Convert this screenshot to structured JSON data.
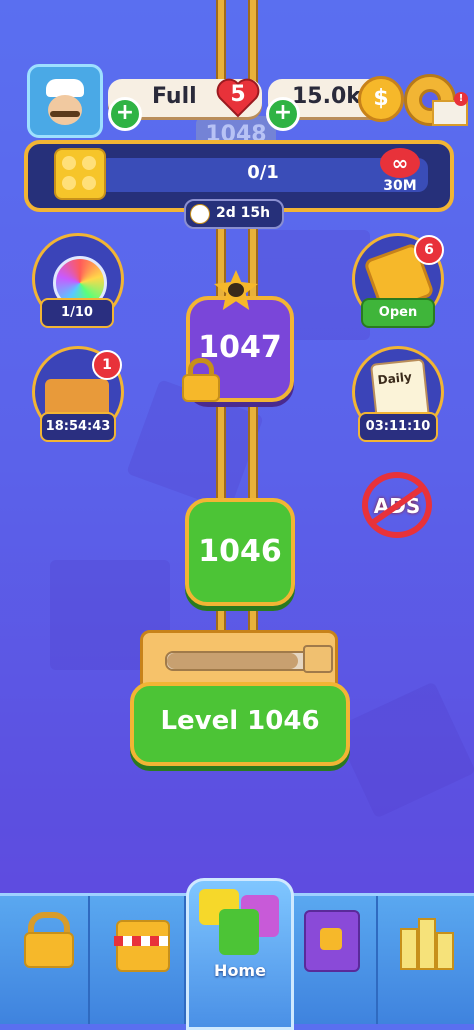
{
  "header": {
    "lives_label": "Full",
    "lives_count": "5",
    "coins": "15.0k"
  },
  "event": {
    "progress": "0/1",
    "progress_fraction": 0,
    "reward_label": "30M",
    "timer": "2d 15h"
  },
  "left_side": [
    {
      "label": "1/10",
      "icon": "rainbow-potion-icon"
    },
    {
      "label": "18:54:43",
      "icon": "brick-castle-icon",
      "badge": "1"
    }
  ],
  "right_side": [
    {
      "label": "Open",
      "icon": "brick-box-icon",
      "badge": "6"
    },
    {
      "label": "03:11:10",
      "icon": "daily-notebook-icon",
      "title": "Daily"
    }
  ],
  "ads_label": "ADS",
  "map": {
    "locked_level": "1047",
    "current_level": "1046",
    "behind_level": "1048"
  },
  "play_button": "Level 1046",
  "level_progress_fraction": 0.9,
  "nav": [
    {
      "icon": "lock-icon"
    },
    {
      "icon": "shop-icon"
    },
    {
      "icon": "home-blocks-icon",
      "label": "Home"
    },
    {
      "icon": "collection-book-icon"
    },
    {
      "icon": "building-blocks-icon"
    }
  ],
  "colors": {
    "accent": "#f2b534",
    "green": "#4cc436",
    "purple": "#7a46d9",
    "red": "#e8323a"
  }
}
